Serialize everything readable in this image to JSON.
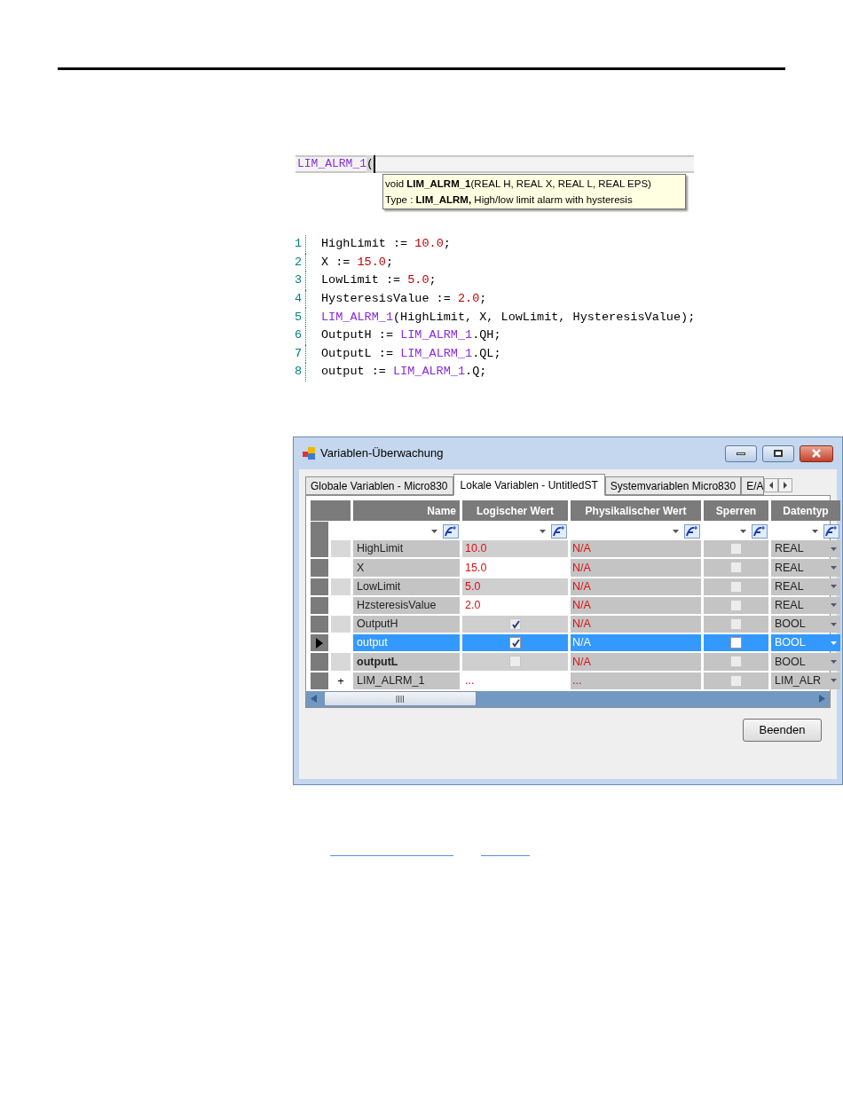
{
  "editor_line": {
    "function_name": "LIM_ALRM_1",
    "paren": "("
  },
  "tooltip": {
    "signature": "void **LIM_ALRM_1**(REAL H, REAL X, REAL L, REAL EPS)",
    "type_line": "Type : **LIM_ALRM,** High/low limit alarm with hysteresis"
  },
  "code_lines": [
    {
      "number": "1",
      "parts": [
        {
          "kind": "plain",
          "text": "HighLimit := "
        },
        {
          "kind": "number",
          "text": "10.0"
        },
        {
          "kind": "plain",
          "text": ";"
        }
      ]
    },
    {
      "number": "2",
      "parts": [
        {
          "kind": "plain",
          "text": "X := "
        },
        {
          "kind": "number",
          "text": "15.0"
        },
        {
          "kind": "plain",
          "text": ";"
        }
      ]
    },
    {
      "number": "3",
      "parts": [
        {
          "kind": "plain",
          "text": "LowLimit := "
        },
        {
          "kind": "number",
          "text": "5.0"
        },
        {
          "kind": "plain",
          "text": ";"
        }
      ]
    },
    {
      "number": "4",
      "parts": [
        {
          "kind": "plain",
          "text": "HysteresisValue := "
        },
        {
          "kind": "number",
          "text": "2.0"
        },
        {
          "kind": "plain",
          "text": ";"
        }
      ]
    },
    {
      "number": "5",
      "parts": [
        {
          "kind": "function",
          "text": "LIM_ALRM_1"
        },
        {
          "kind": "plain",
          "text": "(HighLimit, X, LowLimit, HysteresisValue);"
        }
      ]
    },
    {
      "number": "6",
      "parts": [
        {
          "kind": "plain",
          "text": "OutputH := "
        },
        {
          "kind": "function",
          "text": "LIM_ALRM_1"
        },
        {
          "kind": "plain",
          "text": ".QH;"
        }
      ]
    },
    {
      "number": "7",
      "parts": [
        {
          "kind": "plain",
          "text": "OutputL := "
        },
        {
          "kind": "function",
          "text": "LIM_ALRM_1"
        },
        {
          "kind": "plain",
          "text": ".QL;"
        }
      ]
    },
    {
      "number": "8",
      "parts": [
        {
          "kind": "plain",
          "text": "output := "
        },
        {
          "kind": "function",
          "text": "LIM_ALRM_1"
        },
        {
          "kind": "plain",
          "text": ".Q;"
        }
      ]
    }
  ],
  "window": {
    "title": "Variablen-Überwachung",
    "tabs": [
      {
        "label": "Globale Variablen - Micro830",
        "selected": false
      },
      {
        "label": "Lokale Variablen - UntitledST",
        "selected": true
      },
      {
        "label": "Systemvariablen Micro830",
        "selected": false
      },
      {
        "label": "E/A",
        "selected": false
      }
    ],
    "columns": [
      "Name",
      "Logischer Wert",
      "Physikalischer Wert",
      "Sperren",
      "Datentyp"
    ],
    "rows": [
      {
        "name": "HighLimit",
        "kind": "value",
        "value": "10.0",
        "physical": "N/A",
        "locked": false,
        "type": "REAL",
        "selected": false,
        "expandable": false
      },
      {
        "name": "X",
        "kind": "value",
        "value": "15.0",
        "physical": "N/A",
        "locked": false,
        "type": "REAL",
        "selected": false,
        "expandable": false
      },
      {
        "name": "LowLimit",
        "kind": "value",
        "value": "5.0",
        "physical": "N/A",
        "locked": false,
        "type": "REAL",
        "selected": false,
        "expandable": false
      },
      {
        "name": "HzsteresisValue",
        "kind": "value",
        "value": "2.0",
        "physical": "N/A",
        "locked": false,
        "type": "REAL",
        "selected": false,
        "expandable": false
      },
      {
        "name": "OutputH",
        "kind": "bool",
        "checked": true,
        "physical": "N/A",
        "locked": false,
        "type": "BOOL",
        "selected": false,
        "expandable": false
      },
      {
        "name": "output",
        "kind": "bool",
        "checked": true,
        "physical": "N/A",
        "locked": false,
        "type": "BOOL",
        "selected": true,
        "expandable": false
      },
      {
        "name": "outputL",
        "kind": "bool",
        "checked": false,
        "physical": "N/A",
        "locked": false,
        "type": "BOOL",
        "selected": false,
        "expandable": false
      },
      {
        "name": "LIM_ALRM_1",
        "kind": "value",
        "value": "...",
        "physical": "...",
        "locked": false,
        "type": "LIM_ALR",
        "selected": false,
        "expandable": true,
        "expander": "+"
      }
    ],
    "close_button": "Beenden"
  }
}
